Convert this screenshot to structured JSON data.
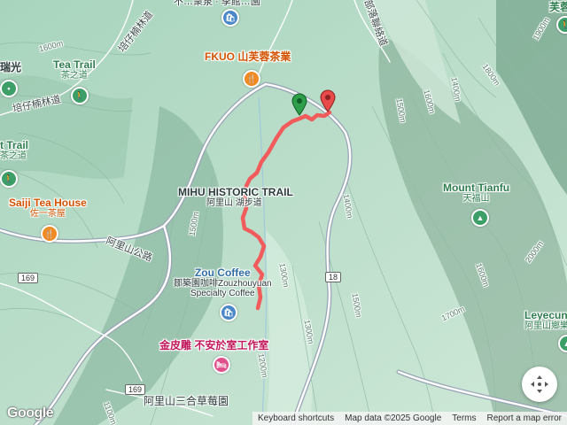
{
  "map": {
    "pois": [
      {
        "id": "fkuo",
        "name": "FKUO 山芙蓉茶業",
        "style": "orange",
        "icon": "restaurant-icon"
      },
      {
        "id": "tea-trail",
        "name": "Tea Trail",
        "sub": "茶之道",
        "style": "green",
        "icon": "hiking-icon"
      },
      {
        "id": "tea-trail-west",
        "name": "t Trail",
        "sub": "茶之道",
        "style": "green",
        "icon": "hiking-icon"
      },
      {
        "id": "saiji",
        "name": "Saiji Tea House",
        "sub": "佐一茶屋",
        "style": "orange",
        "icon": "restaurant-icon"
      },
      {
        "id": "mihu",
        "name": "MIHU HISTORIC TRAIL",
        "sub": "阿里山",
        "sub2": "湖步道",
        "style": "dark"
      },
      {
        "id": "zou",
        "name": "Zou Coffee",
        "sub": "鄒築園咖啡Zouzhouyuan",
        "sub2": "Specialty Coffee",
        "style": "dark",
        "icon": "shopping-bag-icon"
      },
      {
        "id": "jinpidiao",
        "name": "金皮雕 不安於室工作室",
        "style": "pink",
        "icon": "bed-icon"
      },
      {
        "id": "strawberry",
        "name": "阿里山三合草莓園",
        "style": "dark"
      },
      {
        "id": "tianfu",
        "name": "Mount Tianfu",
        "sub": "天福山",
        "style": "green",
        "icon": "mountain-icon"
      },
      {
        "id": "leyecun",
        "name": "Leyecun",
        "sub": "阿里山鄉樂",
        "style": "green"
      },
      {
        "id": "ruiguang",
        "name": "瑞光",
        "style": "dark"
      },
      {
        "id": "furong",
        "name": "芙蓉",
        "style": "green"
      }
    ],
    "roads": [
      {
        "id": "alishan-rd",
        "name": "阿里山公路"
      },
      {
        "id": "peizai-rd",
        "name": "培仔楠林道"
      },
      {
        "id": "peizai-rd-2",
        "name": "培仔楠林道"
      },
      {
        "id": "tribal-rd",
        "name": "部落聯絡道"
      }
    ],
    "road_shields": [
      "169",
      "169",
      "18",
      "169"
    ],
    "contours": [
      "1600m",
      "1500m",
      "1400m",
      "1300m",
      "1200m",
      "1100m",
      "1500m",
      "1600m",
      "1800m",
      "1900m",
      "2000m",
      "1700m",
      "1600m",
      "1500m",
      "1400m",
      "1300m"
    ],
    "top_partial_label": "不…衆泉 · 季館…園",
    "markers": {
      "start": "start-pin-icon",
      "end": "end-pin-icon"
    },
    "track_color": "#f25b5b"
  },
  "footer": {
    "logo": "Google",
    "shortcuts": "Keyboard shortcuts",
    "data": "Map data ©2025 Google",
    "terms": "Terms",
    "report": "Report a map error"
  },
  "controls": {
    "recenter": "move-arrows-icon"
  }
}
